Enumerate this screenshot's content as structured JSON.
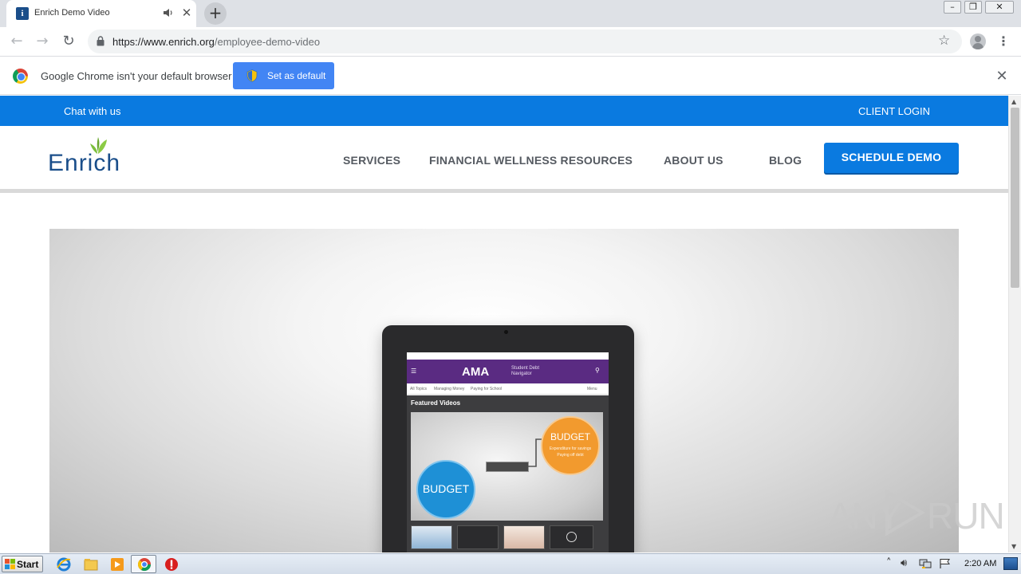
{
  "browser": {
    "tab": {
      "title": "Enrich Demo Video",
      "favicon": "enrich-favicon",
      "audio_icon": "speaker-icon",
      "close_glyph": "✕"
    },
    "new_tab_glyph": "+",
    "window_buttons": {
      "minimize": "–",
      "restore": "❐",
      "close": "✕"
    },
    "nav": {
      "back": "←",
      "forward": "→",
      "reload": "↻"
    },
    "address": {
      "url_host": "https://www.enrich.org",
      "url_path": "/employee-demo-video",
      "star": "☆",
      "menu": "⋮"
    },
    "infobar": {
      "message": "Google Chrome isn't your default browser",
      "button_label": "Set as default",
      "close_glyph": "✕"
    }
  },
  "site": {
    "topbar": {
      "chat_label": "Chat with us",
      "client_login": "CLIENT LOGIN"
    },
    "logo_text": "Enrich",
    "nav": [
      {
        "label": "SERVICES"
      },
      {
        "label": "FINANCIAL WELLNESS RESOURCES"
      },
      {
        "label": "ABOUT US"
      },
      {
        "label": "BLOG"
      }
    ],
    "cta_label": "SCHEDULE DEMO",
    "video": {
      "app_brand": "AMA",
      "app_subtitle_1": "Student Debt",
      "app_subtitle_2": "Navigator",
      "menu_items": [
        "All Topics",
        "Managing Money",
        "Paying for School",
        "Menu"
      ],
      "section_title": "Featured Videos",
      "bubble_left": "BUDGET",
      "bubble_right": "BUDGET",
      "bubble_right_sub_1": "Expenditure for savings",
      "bubble_right_sub_2": "Paying off debt"
    },
    "watermark": {
      "left": "ANY",
      "right": "RUN"
    }
  },
  "taskbar": {
    "start_label": "Start",
    "clock": "2:20 AM",
    "apps": [
      "internet-explorer-icon",
      "file-explorer-icon",
      "media-player-icon",
      "chrome-icon",
      "stop-icon"
    ],
    "tray": [
      "show-hidden-icons-icon",
      "volume-icon",
      "network-icon",
      "action-center-flag-icon"
    ]
  },
  "colors": {
    "brand_blue": "#0a7ae0",
    "logo_blue": "#1a4e8a",
    "logo_green": "#7bbf3b",
    "ama_purple": "#5a2b82",
    "budget_blue": "#1e90d6",
    "budget_orange": "#f29a2e"
  }
}
